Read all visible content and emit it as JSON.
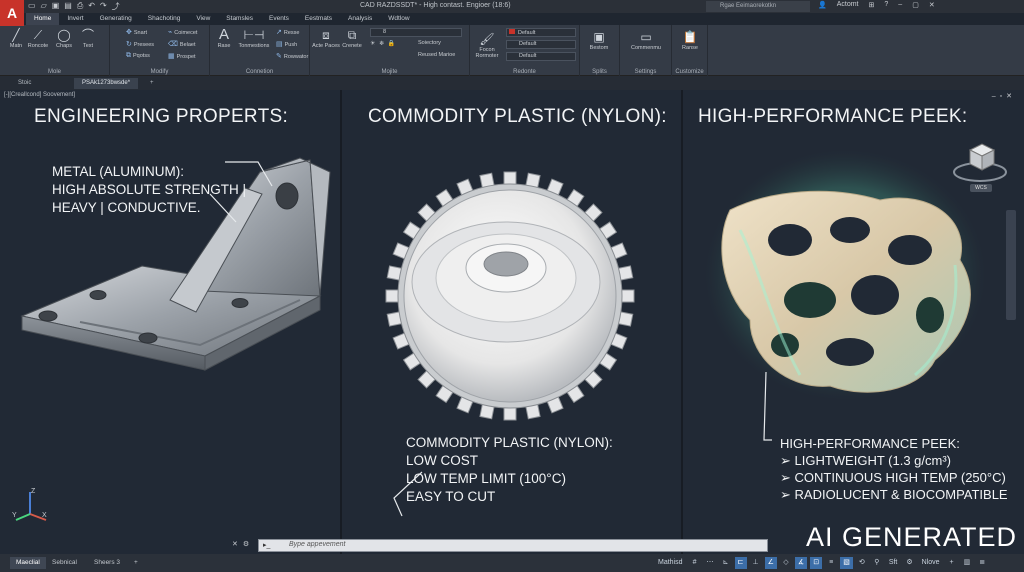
{
  "window": {
    "title": "CAD RAZDSSDT* - High contast. Engioer (18:6)",
    "search_placeholder": "Rgae Eeimaorekotkn",
    "account": "Actomt",
    "logo_letter": "A"
  },
  "ribbon": {
    "tabs": [
      "Home",
      "Invert",
      "Generating",
      "Shachoting",
      "View",
      "Stamsles",
      "Events",
      "Eestmats",
      "Analysis",
      "Wdtlow"
    ],
    "active_tab": "Home",
    "panels": {
      "mode": {
        "title": "Mole",
        "tools": [
          "Matn",
          "Roncote",
          "Chaps",
          "Text"
        ]
      },
      "modify": {
        "title": "Modify",
        "tools": [
          "Snart",
          "Presees",
          "Pqotss",
          "Coimecet",
          "Belaet",
          "Prospet"
        ]
      },
      "connection": {
        "title": "Connetion",
        "tools": [
          "Rase",
          "Tonmestions",
          "Resse",
          "Push",
          "Rowwator"
        ]
      },
      "mojite": {
        "title": "Mojite",
        "tools": [
          "Acte Paces",
          "Crenete",
          "Soiectory",
          "Reused Marioe"
        ],
        "layer_value": "8"
      },
      "redonte": {
        "title": "Redonte",
        "tools": [
          "Focon Rormoter"
        ],
        "color_value": "Default",
        "linetype_value": "Default",
        "lineweight_value": "Default"
      },
      "splits": {
        "title": "Splits",
        "tools": [
          "Bestom"
        ]
      },
      "settings": {
        "title": "Settings",
        "tools": [
          "Commenmu"
        ]
      },
      "customize": {
        "title": "Customize",
        "tools": [
          "Ranse"
        ]
      }
    }
  },
  "file_tabs": [
    "Stoic",
    "PSAk1273bwsde*",
    "+"
  ],
  "viewport": {
    "label": "[-][Creallcond] Soovement]",
    "sections": {
      "metal": {
        "heading": "ENGINEERING PROPERTS:",
        "note_lines": [
          "METAL (ALUMINUM):",
          "HIGH ABSOLUTE STRENGTH |",
          "HEAVY | CONDUCTIVE."
        ]
      },
      "nylon": {
        "heading": "COMMODITY PLASTIC (NYLON):",
        "note_lines": [
          "COMMODITY PLASTIC (NYLON):",
          "LOW COST",
          "LOW TEMP LIMIT (100°C)",
          "EASY TO CUT"
        ]
      },
      "peek": {
        "heading": "HIGH-PERFORMANCE PEEK:",
        "note_lines": [
          "HIGH-PERFORMANCE PEEK:",
          "➢ LIGHTWEIGHT (1.3 g/cm³)",
          "➢ CONTINUOUS HIGH TEMP (250°C)",
          "➢ RADIOLUCENT & BIOCOMPATIBLE"
        ]
      }
    },
    "viewcube_label": "WCS",
    "ucs_axes": [
      "Z",
      "X",
      "Y"
    ]
  },
  "command_line": {
    "placeholder": "Bype appevement"
  },
  "watermark": "AI GENERATED",
  "status_bar": {
    "layout_tabs": [
      "Maeclial",
      "Sebnical",
      "Sheers 3",
      "+"
    ],
    "model_label": "Mathisd",
    "scale": "Sft",
    "workspace": "Nlove"
  },
  "colors": {
    "peek_glow": "#7ff0c8",
    "accent": "#3c6ea8",
    "logo": "#c8332a"
  }
}
